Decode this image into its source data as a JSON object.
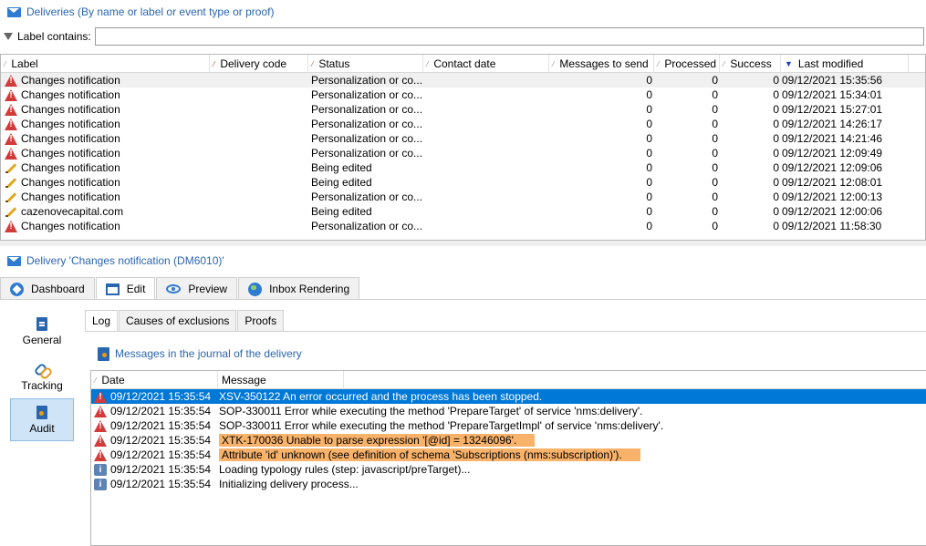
{
  "deliveries_title": "Deliveries (By name or label or event type or proof)",
  "filter": {
    "label": "Label contains:",
    "value": ""
  },
  "grid": {
    "columns": {
      "label": "Label",
      "delivery_code": "Delivery code",
      "status": "Status",
      "contact_date": "Contact date",
      "messages_to_send": "Messages to send",
      "processed": "Processed",
      "success": "Success",
      "last_modified": "Last modified"
    },
    "rows": [
      {
        "icon": "warning-icon",
        "label": "Changes notification",
        "code": "",
        "status": "Personalization or co...",
        "contact": "",
        "msgs": "0",
        "proc": "0",
        "succ": "0",
        "mod": "09/12/2021 15:35:56"
      },
      {
        "icon": "warning-icon",
        "label": "Changes notification",
        "code": "",
        "status": "Personalization or co...",
        "contact": "",
        "msgs": "0",
        "proc": "0",
        "succ": "0",
        "mod": "09/12/2021 15:34:01"
      },
      {
        "icon": "warning-icon",
        "label": "Changes notification",
        "code": "",
        "status": "Personalization or co...",
        "contact": "",
        "msgs": "0",
        "proc": "0",
        "succ": "0",
        "mod": "09/12/2021 15:27:01"
      },
      {
        "icon": "warning-icon",
        "label": "Changes notification",
        "code": "",
        "status": "Personalization or co...",
        "contact": "",
        "msgs": "0",
        "proc": "0",
        "succ": "0",
        "mod": "09/12/2021 14:26:17"
      },
      {
        "icon": "warning-icon",
        "label": "Changes notification",
        "code": "",
        "status": "Personalization or co...",
        "contact": "",
        "msgs": "0",
        "proc": "0",
        "succ": "0",
        "mod": "09/12/2021 14:21:46"
      },
      {
        "icon": "warning-icon",
        "label": "Changes notification",
        "code": "",
        "status": "Personalization or co...",
        "contact": "",
        "msgs": "0",
        "proc": "0",
        "succ": "0",
        "mod": "09/12/2021 12:09:49"
      },
      {
        "icon": "pencil-icon",
        "label": "Changes notification",
        "code": "",
        "status": "Being edited",
        "contact": "",
        "msgs": "0",
        "proc": "0",
        "succ": "0",
        "mod": "09/12/2021 12:09:06"
      },
      {
        "icon": "pencil-icon",
        "label": "Changes notification",
        "code": "",
        "status": "Being edited",
        "contact": "",
        "msgs": "0",
        "proc": "0",
        "succ": "0",
        "mod": "09/12/2021 12:08:01"
      },
      {
        "icon": "pencil-icon",
        "label": "Changes notification",
        "code": "",
        "status": "Personalization or co...",
        "contact": "",
        "msgs": "0",
        "proc": "0",
        "succ": "0",
        "mod": "09/12/2021 12:00:13"
      },
      {
        "icon": "pencil-icon",
        "label": "cazenovecapital.com",
        "code": "",
        "status": "Being edited",
        "contact": "",
        "msgs": "0",
        "proc": "0",
        "succ": "0",
        "mod": "09/12/2021 12:00:06"
      },
      {
        "icon": "warning-icon",
        "label": "Changes notification",
        "code": "",
        "status": "Personalization or co...",
        "contact": "",
        "msgs": "0",
        "proc": "0",
        "succ": "0",
        "mod": "09/12/2021 11:58:30"
      }
    ]
  },
  "delivery_title": "Delivery 'Changes notification (DM6010)'",
  "tabs": [
    {
      "label": "Dashboard",
      "icon": "dashboard-icon"
    },
    {
      "label": "Edit",
      "icon": "edit-icon"
    },
    {
      "label": "Preview",
      "icon": "preview-icon"
    },
    {
      "label": "Inbox Rendering",
      "icon": "globe-icon"
    }
  ],
  "leftnav": {
    "general": "General",
    "tracking": "Tracking",
    "audit": "Audit"
  },
  "subtabs": [
    "Log",
    "Causes of exclusions",
    "Proofs"
  ],
  "journal_title": "Messages in the journal of the delivery",
  "log": {
    "columns": {
      "date": "Date",
      "message": "Message"
    },
    "rows": [
      {
        "icon": "warning-icon",
        "date": "09/12/2021 15:35:54",
        "message": "XSV-350122 An error occurred and the process has been stopped.",
        "selected": true,
        "highlight": false
      },
      {
        "icon": "warning-icon",
        "date": "09/12/2021 15:35:54",
        "message": "SOP-330011 Error while executing the method 'PrepareTarget' of service 'nms:delivery'.",
        "selected": false,
        "highlight": false
      },
      {
        "icon": "warning-icon",
        "date": "09/12/2021 15:35:54",
        "message": "SOP-330011 Error while executing the method 'PrepareTargetImpl' of service 'nms:delivery'.",
        "selected": false,
        "highlight": false
      },
      {
        "icon": "warning-icon",
        "date": "09/12/2021 15:35:54",
        "message": "XTK-170036 Unable to parse expression '[@id] = 13246096'.",
        "selected": false,
        "highlight": true
      },
      {
        "icon": "warning-icon",
        "date": "09/12/2021 15:35:54",
        "message": "Attribute 'id' unknown (see definition of schema 'Subscriptions (nms:subscription)').",
        "selected": false,
        "highlight": true
      },
      {
        "icon": "info-icon",
        "date": "09/12/2021 15:35:54",
        "message": "Loading typology rules (step: javascript/preTarget)...",
        "selected": false,
        "highlight": false
      },
      {
        "icon": "info-icon",
        "date": "09/12/2021 15:35:54",
        "message": "Initializing delivery process...",
        "selected": false,
        "highlight": false
      }
    ]
  },
  "colors": {
    "accent": "#2a66b0",
    "selection": "#0078d7",
    "highlight": "#f8b26a",
    "error": "#d33a3a"
  }
}
